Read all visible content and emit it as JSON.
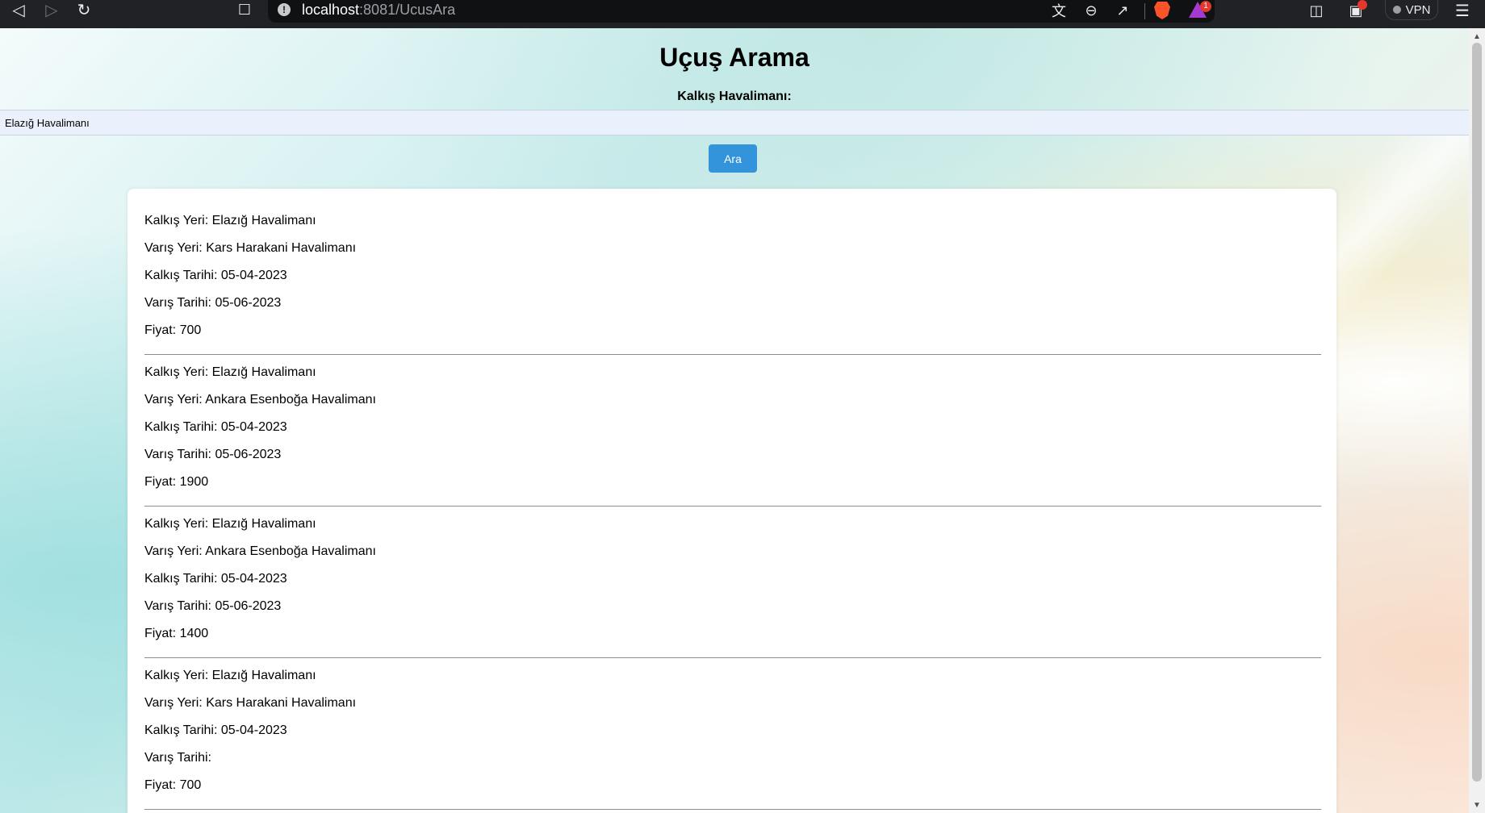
{
  "browser": {
    "url_host": "localhost",
    "url_path": ":8081/UcusAra",
    "notification_count": "1",
    "vpn_label": "VPN",
    "icons": [
      "back-icon",
      "forward-icon",
      "reload-icon",
      "bookmark-icon",
      "info-icon",
      "translate-icon",
      "zoom-out-icon",
      "share-icon",
      "brave-shields-icon",
      "brave-rewards-icon",
      "sidebar-icon",
      "wallet-icon",
      "menu-icon"
    ]
  },
  "page": {
    "title": "Uçuş Arama",
    "departure_label": "Kalkış Havalimanı:",
    "selected_airport": "Elazığ Havalimanı",
    "search_button_label": "Ara"
  },
  "flights": [
    {
      "from": "Kalkış Yeri: Elazığ Havalimanı",
      "to": "Varış Yeri: Kars Harakani Havalimanı",
      "departure_date": "Kalkış Tarihi: 05-04-2023",
      "arrival_date": "Varış Tarihi: 05-06-2023",
      "price": "Fiyat: 700"
    },
    {
      "from": "Kalkış Yeri: Elazığ Havalimanı",
      "to": "Varış Yeri: Ankara Esenboğa Havalimanı",
      "departure_date": "Kalkış Tarihi: 05-04-2023",
      "arrival_date": "Varış Tarihi: 05-06-2023",
      "price": "Fiyat: 1900"
    },
    {
      "from": "Kalkış Yeri: Elazığ Havalimanı",
      "to": "Varış Yeri: Ankara Esenboğa Havalimanı",
      "departure_date": "Kalkış Tarihi: 05-04-2023",
      "arrival_date": "Varış Tarihi: 05-06-2023",
      "price": "Fiyat: 1400"
    },
    {
      "from": "Kalkış Yeri: Elazığ Havalimanı",
      "to": "Varış Yeri: Kars Harakani Havalimanı",
      "departure_date": "Kalkış Tarihi: 05-04-2023",
      "arrival_date": "Varış Tarihi:",
      "price": "Fiyat: 700"
    }
  ]
}
